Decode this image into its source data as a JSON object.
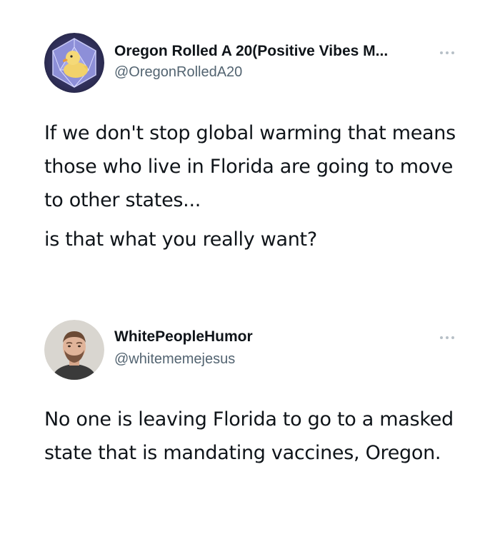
{
  "tweets": [
    {
      "display_name": "Oregon Rolled A 20(Positive Vibes M...",
      "handle": "@OregonRolledA20",
      "avatar_icon": "rubber-duck-d20-icon",
      "more_icon": "more-options-icon",
      "text_lines": [
        "If we don't stop global warming that means those who live in Florida are going to move to other states...",
        "is that what you really want?"
      ]
    },
    {
      "display_name": "WhitePeopleHumor",
      "handle": "@whitememejesus",
      "avatar_icon": "profile-photo-icon",
      "more_icon": "more-options-icon",
      "text_lines": [
        "No one is leaving Florida to go to a masked state that is mandating vaccines, Oregon."
      ]
    }
  ],
  "colors": {
    "background": "#ffffff",
    "text_primary": "#0f1419",
    "text_secondary": "#536471",
    "icon_muted": "#b7c0c7"
  }
}
